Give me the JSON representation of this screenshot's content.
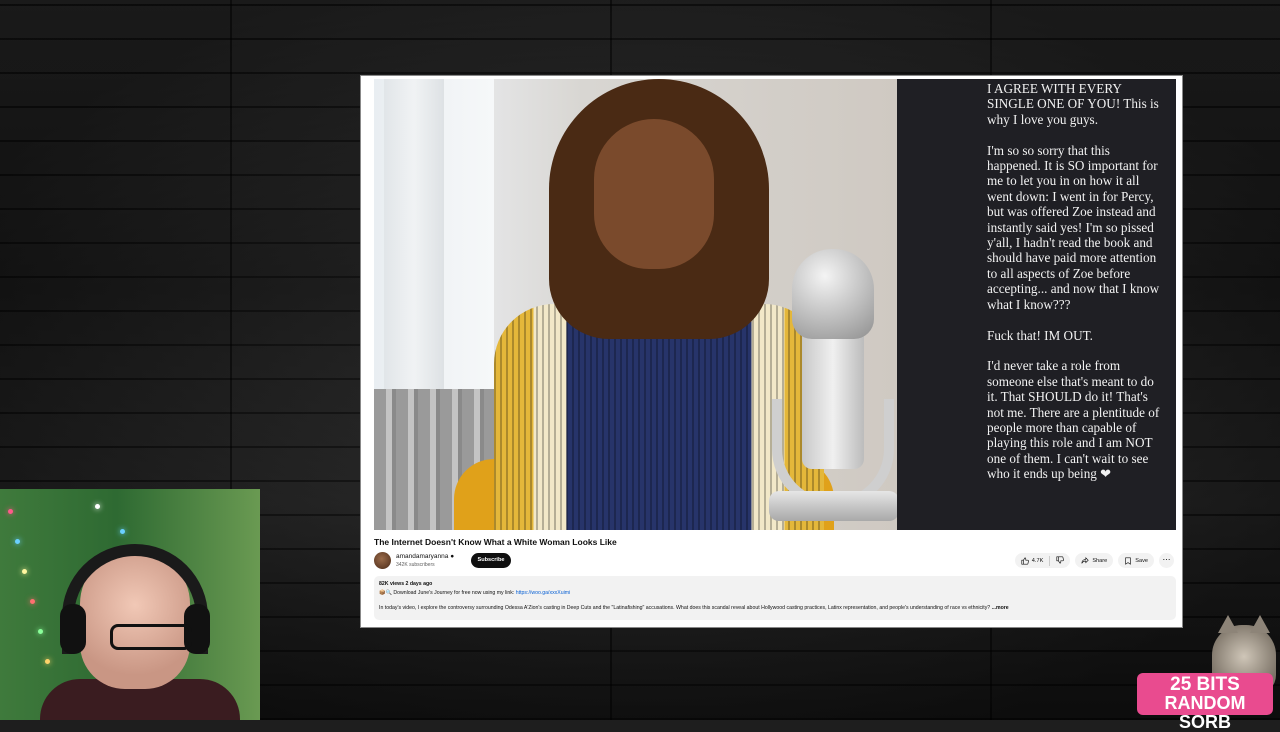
{
  "video": {
    "title": "The Internet Doesn't Know What a White Woman Looks Like",
    "overlay_text": "I AGREE WITH EVERY SINGLE ONE OF YOU! This is why I love you guys.\n\nI'm so so sorry that this happened. It is SO important for me to let you in on how it all went down: I went in for Percy, but was offered Zoe instead and instantly said yes! I'm so pissed y'all, I hadn't read the book and should have paid more attention to all aspects of Zoe before accepting... and now that I know what I know???\n\nFuck that! IM OUT.\n\nI'd never take a role from someone else that's meant to do it. That SHOULD do it! That's not me. There are a plentitude of people more than capable of playing this role and I am NOT one of them. I can't wait to see who it ends up being ❤"
  },
  "channel": {
    "name": "amandamaryanna",
    "subscribers": "342K subscribers",
    "subscribe_label": "Subscribe"
  },
  "actions": {
    "likes": "4.7K",
    "share_label": "Share",
    "save_label": "Save",
    "more_label": "⋯"
  },
  "description": {
    "meta": "82K views  2 days ago",
    "promo": "📦🔍 Download June's Journey for free now using my link: ",
    "promo_link": "https://woo.ga/xxxXuimi",
    "body": "In today's video, I explore the controversy surrounding Odessa A'Zion's casting in Deep Cuts and the \"Latinafishing\" accusations. What does this scandal reveal about Hollywood casting practices, Latinx representation, and people's understanding of race vs ethnicity? ",
    "more_label": "...more"
  },
  "badge": {
    "line1": "25 BITS",
    "line2": "RANDOM SORB",
    "color": "#e94b8f"
  }
}
